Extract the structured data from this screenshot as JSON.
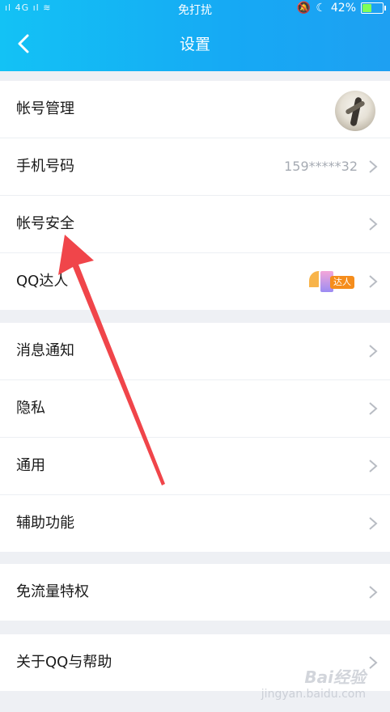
{
  "status_bar": {
    "signal": " ııl 4G ııl",
    "center": "免打扰",
    "battery_percent": "42%",
    "battery_level": 0.42
  },
  "header": {
    "title": "设置"
  },
  "sections": [
    [
      {
        "label": "帐号管理",
        "kind": "avatar"
      },
      {
        "label": "手机号码",
        "value": "159*****32"
      },
      {
        "label": "帐号安全"
      },
      {
        "label": "QQ达人",
        "badge": "达人"
      }
    ],
    [
      {
        "label": "消息通知"
      },
      {
        "label": "隐私"
      },
      {
        "label": "通用"
      },
      {
        "label": "辅助功能"
      }
    ],
    [
      {
        "label": "免流量特权"
      }
    ],
    [
      {
        "label": "关于QQ与帮助"
      }
    ]
  ],
  "watermark": {
    "line1": "Bai经验",
    "line2": "jingyan.baidu.com"
  },
  "colors": {
    "header_start": "#13c2f5",
    "header_end": "#1ea0f2",
    "annotation_arrow": "#f0454a"
  }
}
